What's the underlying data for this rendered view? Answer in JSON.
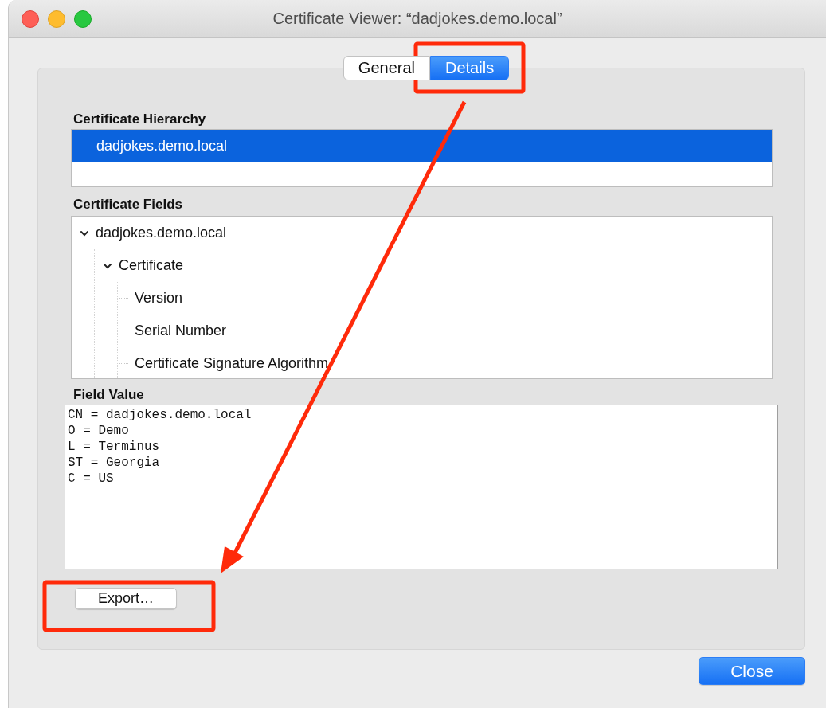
{
  "window": {
    "title": "Certificate Viewer: “dadjokes.demo.local”"
  },
  "tabs": [
    {
      "label": "General",
      "selected": false
    },
    {
      "label": "Details",
      "selected": true
    }
  ],
  "hierarchy": {
    "label": "Certificate Hierarchy",
    "items": [
      {
        "label": "dadjokes.demo.local",
        "selected": true
      }
    ]
  },
  "fields": {
    "label": "Certificate Fields",
    "tree": [
      {
        "label": "dadjokes.demo.local",
        "expanded": true,
        "children": [
          {
            "label": "Certificate",
            "expanded": true,
            "children": [
              {
                "label": "Version"
              },
              {
                "label": "Serial Number"
              },
              {
                "label": "Certificate Signature Algorithm"
              }
            ]
          }
        ]
      }
    ]
  },
  "field_value": {
    "label": "Field Value",
    "lines": [
      "CN = dadjokes.demo.local",
      "O = Demo",
      "L = Terminus",
      "ST = Georgia",
      "C = US"
    ]
  },
  "buttons": {
    "export": "Export…",
    "close": "Close"
  }
}
